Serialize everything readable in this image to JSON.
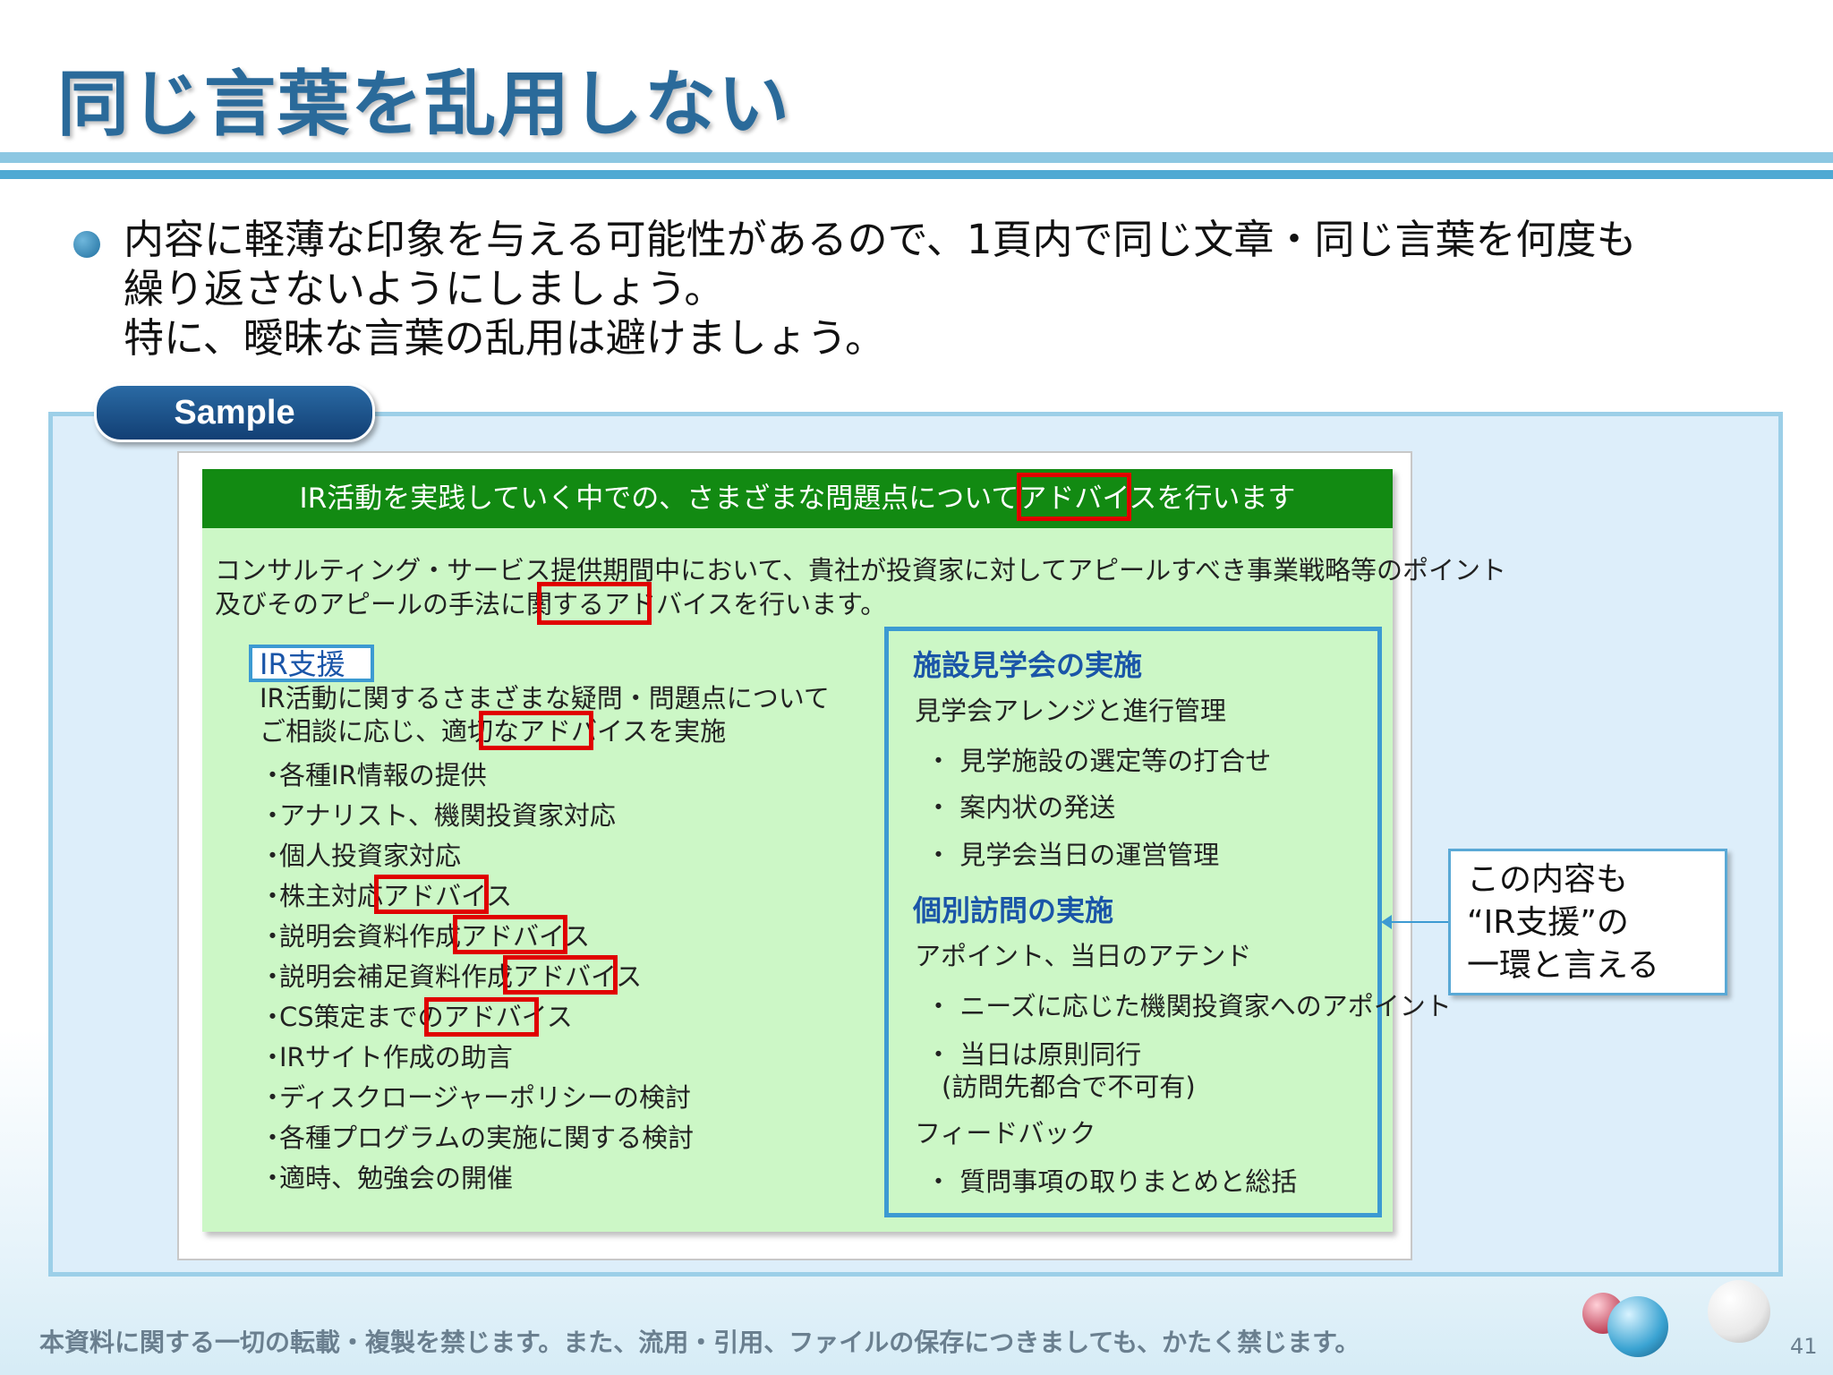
{
  "slide": {
    "title": "同じ言葉を乱用しない",
    "bullet": {
      "lines": [
        "内容に軽薄な印象を与える可能性があるので、1頁内で同じ文章・同じ言葉を何度も",
        "繰り返さないようにしましょう。",
        "特に、曖昧な言葉の乱用は避けましょう。"
      ]
    },
    "sample_label": "Sample",
    "sample": {
      "header": "IR活動を実践していく中での、さまざまな問題点についてアドバイスを行います",
      "intro": [
        "コンサルティング・サービス提供期間中において、貴社が投資家に対してアピールすべき事業戦略等のポイント",
        "及びそのアピールの手法に関するアドバイスを行います。"
      ],
      "ir_support": {
        "label": "IR支援",
        "description": [
          "IR活動に関するさまざまな疑問・問題点について",
          "ご相談に応じ、適切なアドバイスを実施"
        ],
        "items": [
          "各種IR情報の提供",
          "アナリスト、機関投資家対応",
          "個人投資家対応",
          "株主対応アドバイス",
          "説明会資料作成アドバイス",
          "説明会補足資料作成アドバイス",
          "CS策定までのアドバイス",
          "IRサイト作成の助言",
          "ディスクロージャーポリシーの検討",
          "各種プログラムの実施に関する検討",
          "適時、勉強会の開催"
        ]
      },
      "facility_tour": {
        "heading": "施設見学会の実施",
        "sub": "見学会アレンジと進行管理",
        "items": [
          "見学施設の選定等の打合せ",
          "案内状の発送",
          "見学会当日の運営管理"
        ]
      },
      "individual_visit": {
        "heading": "個別訪問の実施",
        "sub": "アポイント、当日のアテンド",
        "items": [
          "ニーズに応じた機関投資家へのアポイント",
          "当日は原則同行",
          "(訪問先都合で不可有)"
        ],
        "feedback": "フィードバック",
        "feedback_items": [
          "質問事項の取りまとめと総括"
        ]
      }
    },
    "callout": [
      "この内容も",
      "“IR支援”の",
      "一環と言える"
    ],
    "footer": "本資料に関する一切の転載・複製を禁じます。また、流用・引用、ファイルの保存につきましても、かたく禁じます。",
    "page_number": "41",
    "colors": {
      "title": "#2a6a9a",
      "header_green": "#128a12",
      "panel_green": "#ccf7c6",
      "highlight_red": "#e00000",
      "accent_blue": "#3c9ad2"
    }
  }
}
